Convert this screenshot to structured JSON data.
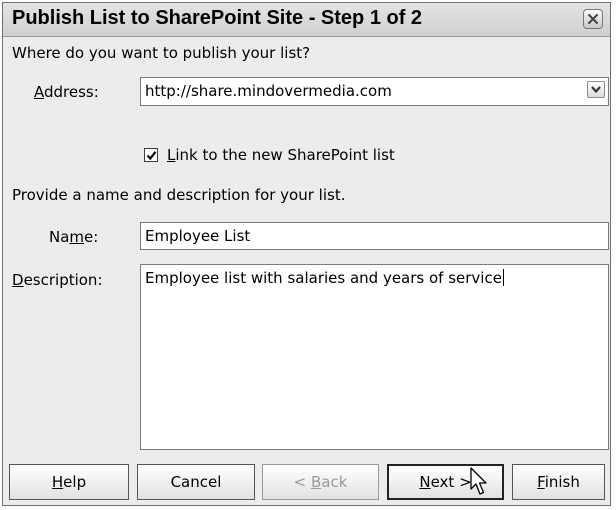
{
  "dialog": {
    "title": "Publish List to SharePoint Site - Step 1 of 2",
    "close_icon": "close-icon"
  },
  "publish": {
    "prompt": "Where do you want to publish your list?",
    "address_label_pre": "",
    "address_label_key": "A",
    "address_label_post": "ddress:",
    "address_value": "http://share.mindovermedia.com",
    "dropdown_icon": "chevron-down-icon",
    "link_checked": true,
    "link_label_key": "L",
    "link_label_post": "ink to the new SharePoint list"
  },
  "details": {
    "prompt": "Provide a name and description for your list.",
    "name_label_pre": "Na",
    "name_label_key": "m",
    "name_label_post": "e:",
    "name_value": "Employee List",
    "description_label_key": "D",
    "description_label_post": "escription:",
    "description_value": "Employee list with salaries and years of service"
  },
  "buttons": {
    "help_key": "H",
    "help_post": "elp",
    "cancel": "Cancel",
    "back_pre": "< ",
    "back_key": "B",
    "back_post": "ack",
    "next_key": "N",
    "next_post": "ext >",
    "finish_key": "F",
    "finish_post": "inish"
  },
  "colors": {
    "dialog_bg": "#ececec",
    "field_bg": "#ffffff",
    "disabled_text": "#9a9a9a"
  }
}
